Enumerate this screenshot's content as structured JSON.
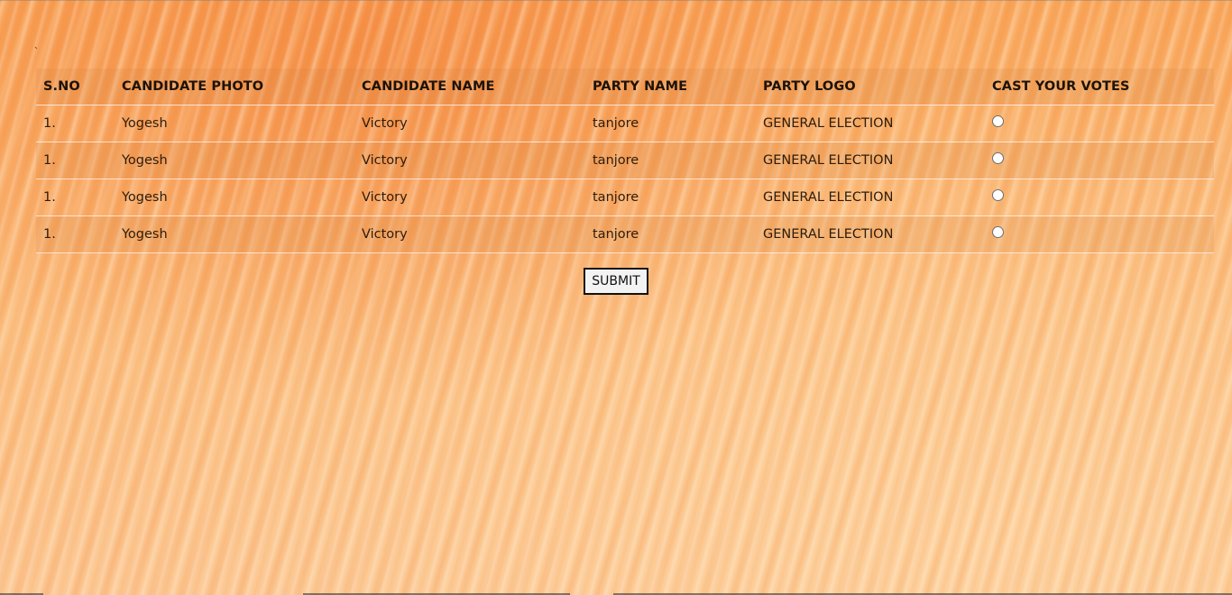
{
  "mark": "`",
  "table": {
    "headers": [
      "S.NO",
      "CANDIDATE PHOTO",
      "CANDIDATE NAME",
      "PARTY NAME",
      "PARTY LOGO",
      "CAST YOUR VOTES"
    ],
    "rows": [
      {
        "sno": "1.",
        "photo": "Yogesh",
        "name": "Victory",
        "party": "tanjore",
        "logo": "GENERAL ELECTION",
        "selected": false
      },
      {
        "sno": "1.",
        "photo": "Yogesh",
        "name": "Victory",
        "party": "tanjore",
        "logo": "GENERAL ELECTION",
        "selected": false
      },
      {
        "sno": "1.",
        "photo": "Yogesh",
        "name": "Victory",
        "party": "tanjore",
        "logo": "GENERAL ELECTION",
        "selected": false
      },
      {
        "sno": "1.",
        "photo": "Yogesh",
        "name": "Victory",
        "party": "tanjore",
        "logo": "GENERAL ELECTION",
        "selected": false
      }
    ]
  },
  "submit_label": "SUBMIT"
}
